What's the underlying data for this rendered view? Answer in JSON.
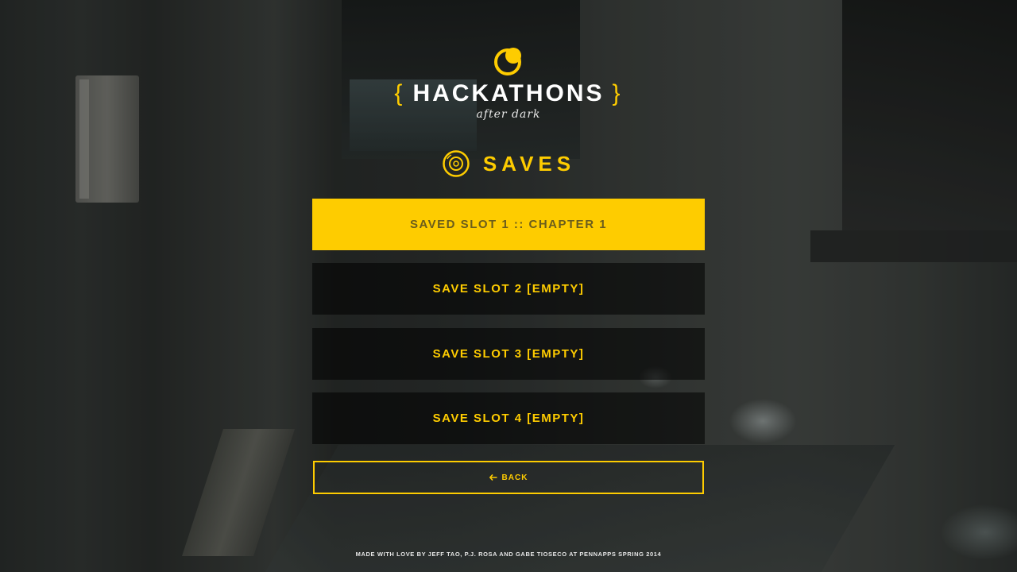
{
  "logo": {
    "title": "HACKATHONS",
    "brace_left": "{",
    "brace_right": "}",
    "subtitle": "after dark",
    "icon": "moon-icon"
  },
  "section": {
    "title": "SAVES",
    "icon": "disc-icon"
  },
  "slots": [
    {
      "label": "SAVED SLOT 1 :: CHAPTER 1",
      "state": "selected"
    },
    {
      "label": "SAVE SLOT 2 [EMPTY]",
      "state": "empty"
    },
    {
      "label": "SAVE SLOT 3 [EMPTY]",
      "state": "empty"
    },
    {
      "label": "SAVE SLOT 4 [EMPTY]",
      "state": "empty"
    }
  ],
  "back": {
    "label": "BACK",
    "icon": "arrow-left-icon"
  },
  "footer": {
    "text": "MADE WITH LOVE BY JEFF TAO, P.J. ROSA AND GABE TIOSECO AT PENNAPPS SPRING 2014"
  },
  "colors": {
    "accent": "#fecc00",
    "selected_text": "#6b5d1c",
    "title_text": "#ffffff"
  }
}
